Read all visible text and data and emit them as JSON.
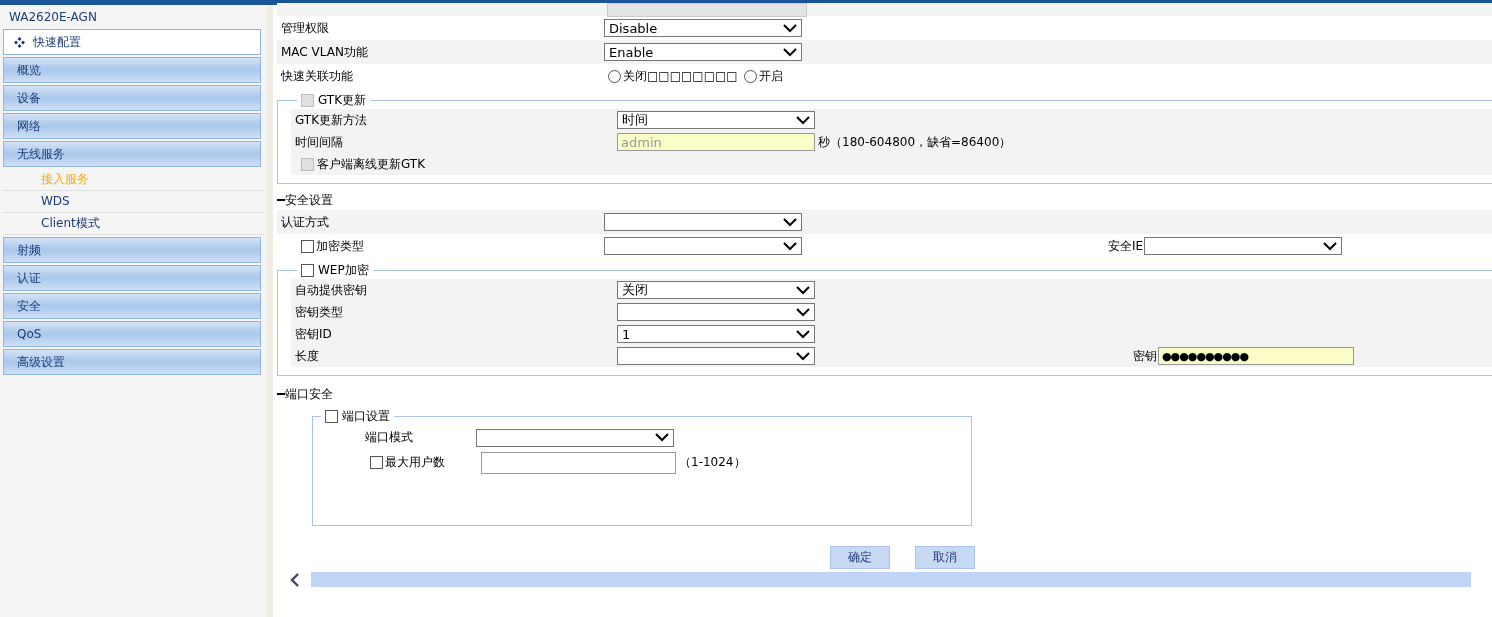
{
  "sidebar": {
    "device": "WA2620E-AGN",
    "quick": {
      "label": "快速配置"
    },
    "items": [
      {
        "label": "概览"
      },
      {
        "label": "设备"
      },
      {
        "label": "网络"
      },
      {
        "label": "无线服务",
        "children": [
          {
            "label": "接入服务",
            "selected": true
          },
          {
            "label": "WDS",
            "selected": false
          },
          {
            "label": "Client模式",
            "selected": false
          }
        ]
      },
      {
        "label": "射频"
      },
      {
        "label": "认证"
      },
      {
        "label": "安全"
      },
      {
        "label": "QoS"
      },
      {
        "label": "高级设置"
      }
    ]
  },
  "top_rows": [
    {
      "kind": "select",
      "label": "管理权限",
      "value": "Disable"
    },
    {
      "kind": "select",
      "label": "MAC VLAN功能",
      "value": "Enable"
    },
    {
      "kind": "radio",
      "label": "快速关联功能",
      "options": [
        {
          "label": "关闭□□□□□□□□",
          "selected": false
        },
        {
          "label": "开启",
          "selected": false
        }
      ]
    }
  ],
  "gtk": {
    "label": "GTK更新",
    "checked": false,
    "disabled": true,
    "rows": [
      {
        "kind": "select",
        "label": "GTK更新方法",
        "value": "时间"
      },
      {
        "kind": "input",
        "label": "时间间隔",
        "placeholder": "admin",
        "hint": "秒（180-604800，缺省=86400）"
      },
      {
        "kind": "check",
        "label": "客户端离线更新GTK",
        "checked": false,
        "disabled": true
      }
    ]
  },
  "security": {
    "title": "安全设置",
    "rows": [
      {
        "kind": "select",
        "label": "认证方式"
      },
      {
        "kind": "checkselect",
        "label": "加密类型",
        "checked": false,
        "right": {
          "label": "安全IE"
        }
      }
    ],
    "wep": {
      "label": "WEP加密",
      "checked": false,
      "disabled": false,
      "rows": [
        {
          "kind": "select",
          "label": "自动提供密钥",
          "value": "关闭"
        },
        {
          "kind": "select",
          "label": "密钥类型"
        },
        {
          "kind": "select",
          "label": "密钥ID",
          "value": "1"
        },
        {
          "kind": "select",
          "label": "长度",
          "right": {
            "label": "密钥",
            "value": "●●●●●●●●●●"
          }
        }
      ]
    }
  },
  "port": {
    "title": "端口安全",
    "label": "端口设置",
    "checked": false,
    "mode": {
      "label": "端口模式"
    },
    "max_users": {
      "label": "最大用户数",
      "checked": false,
      "hint": "（1-1024）"
    }
  },
  "buttons": [
    {
      "label": "确定"
    },
    {
      "label": "取消"
    }
  ]
}
